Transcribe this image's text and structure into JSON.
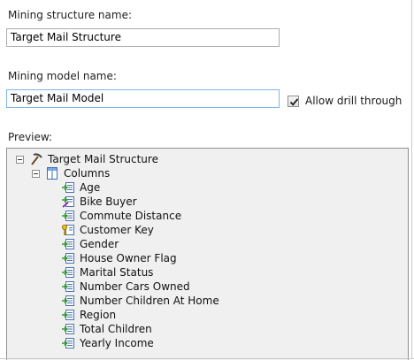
{
  "structure": {
    "label": "Mining structure name:",
    "value": "Target Mail Structure"
  },
  "model": {
    "label": "Mining model name:",
    "value": "Target Mail Model"
  },
  "drill_through": {
    "label": "Allow drill through",
    "checked": true
  },
  "preview": {
    "label": "Preview:",
    "root": {
      "label": "Target Mail Structure",
      "icon": "mining-structure-icon",
      "expanded": true
    },
    "columns_node": {
      "label": "Columns",
      "icon": "columns-folder-icon",
      "expanded": true
    },
    "columns": [
      {
        "label": "Age",
        "icon": "input-column-icon"
      },
      {
        "label": "Bike Buyer",
        "icon": "predict-column-icon"
      },
      {
        "label": "Commute Distance",
        "icon": "input-column-icon"
      },
      {
        "label": "Customer Key",
        "icon": "key-column-icon"
      },
      {
        "label": "Gender",
        "icon": "input-column-icon"
      },
      {
        "label": "House Owner Flag",
        "icon": "input-column-icon"
      },
      {
        "label": "Marital Status",
        "icon": "input-column-icon"
      },
      {
        "label": "Number Cars Owned",
        "icon": "input-column-icon"
      },
      {
        "label": "Number Children At Home",
        "icon": "input-column-icon"
      },
      {
        "label": "Region",
        "icon": "input-column-icon"
      },
      {
        "label": "Total Children",
        "icon": "input-column-icon"
      },
      {
        "label": "Yearly Income",
        "icon": "input-column-icon"
      }
    ]
  }
}
